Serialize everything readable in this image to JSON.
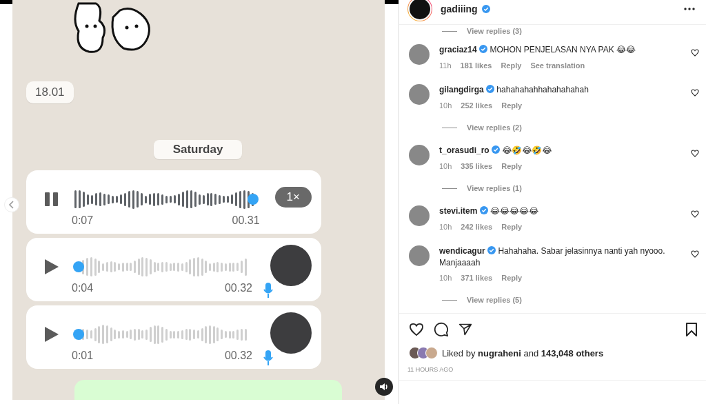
{
  "chat": {
    "time_chip": "18.01",
    "date_chip": "Saturday",
    "voice_messages": [
      {
        "playing": true,
        "level": 0.98,
        "elapsed": "0:07",
        "duration": "00.31",
        "speed": "1×"
      },
      {
        "playing": false,
        "level": 0.0,
        "elapsed": "0:04",
        "duration": "00.32"
      },
      {
        "playing": false,
        "level": 0.0,
        "elapsed": "0:01",
        "duration": "00.32"
      }
    ]
  },
  "post": {
    "username": "gadiiing",
    "verified": true,
    "leading_replies": "View replies (3)",
    "comments": [
      {
        "user": "graciaz14",
        "verified": true,
        "text": [
          "MOHON PENJELASAN NYA PAK 😂😂"
        ],
        "time": "11h",
        "likes": "181 likes",
        "actions": [
          "Reply",
          "See translation"
        ]
      },
      {
        "user": "gilangdirga",
        "verified": true,
        "text": [
          "hahahahahhahahahahah"
        ],
        "time": "10h",
        "likes": "252 likes",
        "actions": [
          "Reply"
        ],
        "view_replies": "View replies (2)"
      },
      {
        "user": "t_orasudi_ro",
        "verified": true,
        "text": [
          "😂🤣😂🤣😂"
        ],
        "time": "10h",
        "likes": "335 likes",
        "actions": [
          "Reply"
        ],
        "view_replies": "View replies (1)"
      },
      {
        "user": "stevi.item",
        "verified": true,
        "text": [
          "😂😂😂😂😂"
        ],
        "time": "10h",
        "likes": "242 likes",
        "actions": [
          "Reply"
        ]
      },
      {
        "user": "wendicagur",
        "verified": true,
        "text": [
          "Hahahaha. Sabar jelasinnya nanti yah nyooo.",
          "Manjaaaah"
        ],
        "time": "10h",
        "likes": "371 likes",
        "actions": [
          "Reply"
        ],
        "view_replies": "View replies (5)"
      }
    ],
    "liked_by": "Liked by **nugraheni** and **143,048 others**",
    "posted": "11 HOURS AGO"
  }
}
